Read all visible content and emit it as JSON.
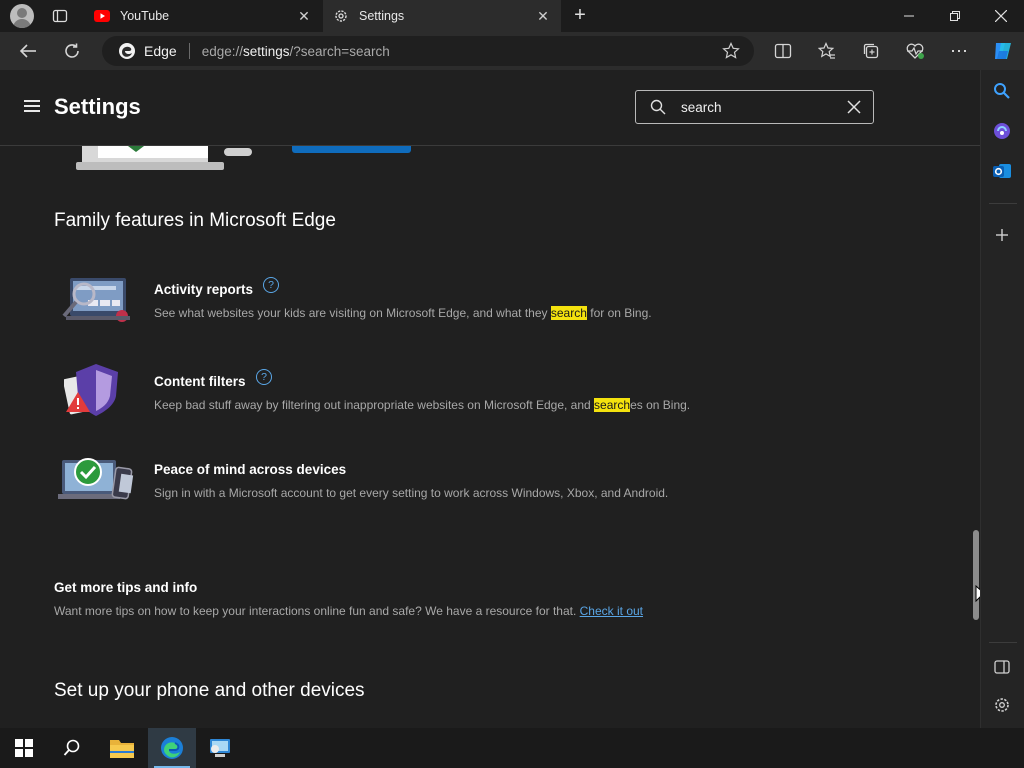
{
  "browser": {
    "tabs": [
      {
        "label": "YouTube",
        "icon": "youtube-icon"
      },
      {
        "label": "Settings",
        "icon": "gear-icon"
      }
    ],
    "address": {
      "site_label": "Edge",
      "url_prefix": "edge://",
      "url_host": "settings",
      "url_rest": "/?search=search"
    }
  },
  "settings": {
    "title": "Settings",
    "search": {
      "value": "search"
    }
  },
  "content": {
    "family_title": "Family features in Microsoft Edge",
    "features": [
      {
        "title": "Activity reports",
        "desc_before": "See what websites your kids are visiting on Microsoft Edge, and what they ",
        "desc_hl": "search",
        "desc_after": " for on Bing.",
        "help": "?"
      },
      {
        "title": "Content filters",
        "desc_before": "Keep bad stuff away by filtering out inappropriate websites on Microsoft Edge, and ",
        "desc_hl": "search",
        "desc_after": "es on Bing.",
        "help": "?"
      },
      {
        "title": "Peace of mind across devices",
        "desc": "Sign in with a Microsoft account to get every setting to work across Windows, Xbox, and Android."
      }
    ],
    "tips_title": "Get more tips and info",
    "tips_desc": "Want more tips on how to keep your interactions online fun and safe? We have a resource for that. ",
    "tips_link": "Check it out",
    "phone_title": "Set up your phone and other devices"
  },
  "colors": {
    "highlight": "#f4e20e",
    "link": "#5aa6e6",
    "accent_button": "#0f6cbd"
  }
}
